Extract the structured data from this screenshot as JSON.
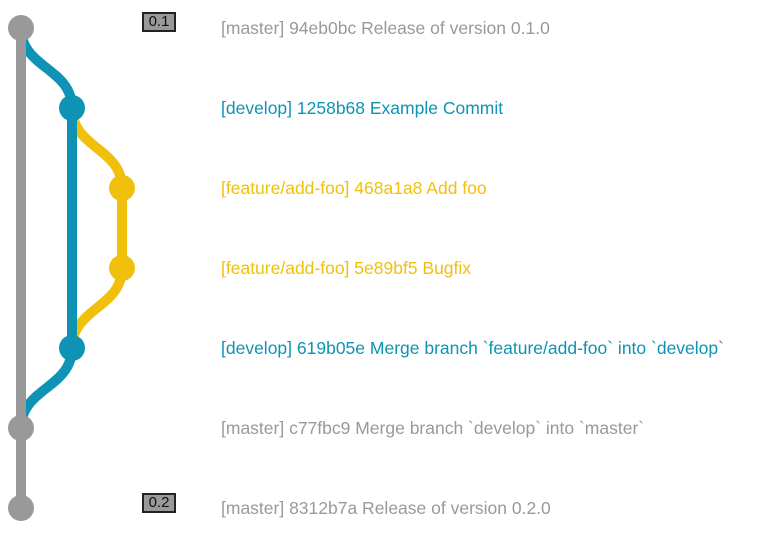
{
  "colors": {
    "master": "#999999",
    "develop": "#0f93b4",
    "feature": "#f1c00d",
    "tag_border": "#222222",
    "tag_fill": "#999999"
  },
  "tags": [
    {
      "label": "0.1",
      "commit_index": 0
    },
    {
      "label": "0.2",
      "commit_index": 6
    }
  ],
  "commits": [
    {
      "branch": "master",
      "lane": 0,
      "text": "[master] 94eb0bc Release of version 0.1.0"
    },
    {
      "branch": "develop",
      "lane": 1,
      "text": "[develop] 1258b68 Example Commit"
    },
    {
      "branch": "feature",
      "lane": 2,
      "text": "[feature/add-foo] 468a1a8 Add foo"
    },
    {
      "branch": "feature",
      "lane": 2,
      "text": "[feature/add-foo] 5e89bf5 Bugfix"
    },
    {
      "branch": "develop",
      "lane": 1,
      "text": "[develop] 619b05e Merge branch `feature/add-foo` into `develop`"
    },
    {
      "branch": "master",
      "lane": 0,
      "text": "[master] c77fbc9 Merge branch `develop` into `master`"
    },
    {
      "branch": "master",
      "lane": 0,
      "text": "[master] 8312b7a Release of version 0.2.0"
    }
  ],
  "edges": [
    {
      "branch": "master",
      "from": 0,
      "to": 5
    },
    {
      "branch": "master",
      "from": 5,
      "to": 6
    },
    {
      "branch": "develop",
      "from": 0,
      "to": 1
    },
    {
      "branch": "develop",
      "from": 1,
      "to": 4
    },
    {
      "branch": "develop",
      "from": 4,
      "to": 5
    },
    {
      "branch": "feature",
      "from": 1,
      "to": 2
    },
    {
      "branch": "feature",
      "from": 2,
      "to": 3
    },
    {
      "branch": "feature",
      "from": 3,
      "to": 4
    }
  ]
}
